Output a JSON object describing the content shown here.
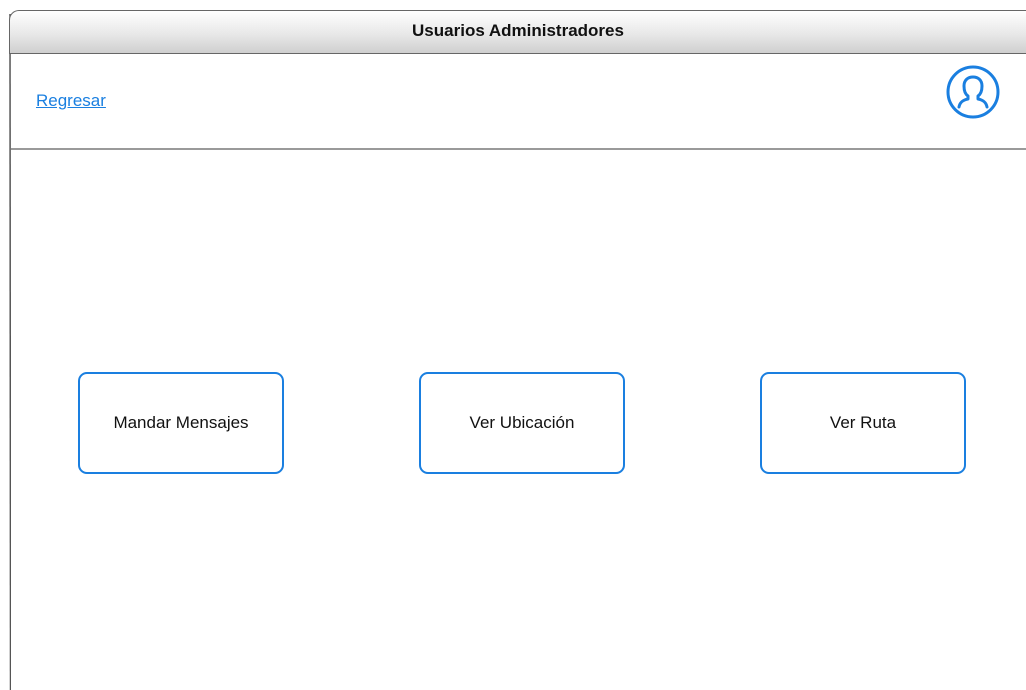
{
  "window": {
    "title": "Usuarios Administradores"
  },
  "header": {
    "back_link": "Regresar",
    "avatar_icon": "user-profile-icon",
    "accent_color": "#1a7fe0"
  },
  "actions": [
    {
      "label": "Mandar Mensajes"
    },
    {
      "label": "Ver Ubicación"
    },
    {
      "label": "Ver Ruta"
    }
  ]
}
